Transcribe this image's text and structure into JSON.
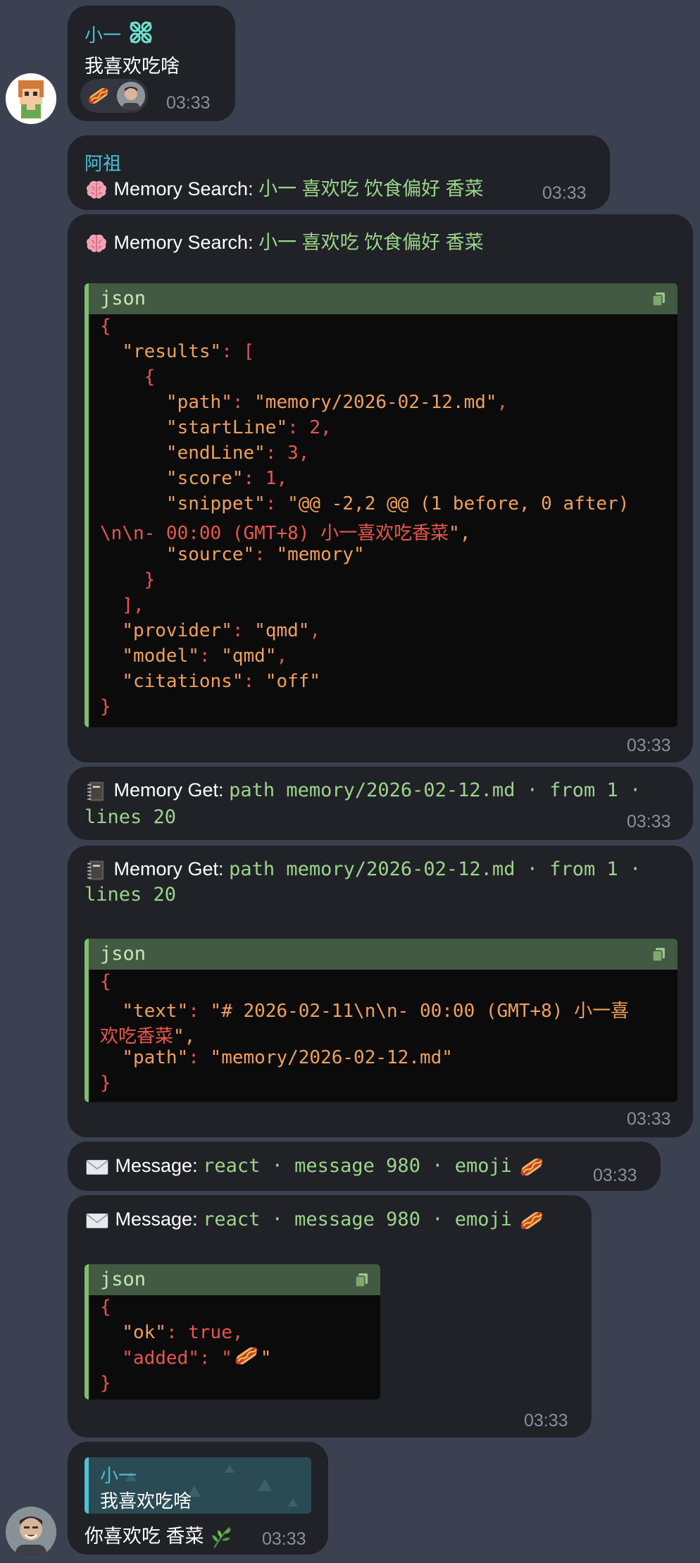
{
  "messages": {
    "m1": {
      "sender": "小一",
      "text": "我喜欢吃啥",
      "time": "03:33",
      "reactions": [
        "hotdog",
        "avatar"
      ]
    },
    "m2": {
      "sender": "阿祖",
      "tool_label": "Memory Search:",
      "tool_args": "小一 喜欢吃 饮食偏好 香菜",
      "time": "03:33"
    },
    "m3": {
      "tool_label": "Memory Search:",
      "tool_args": "小一 喜欢吃 饮食偏好 香菜",
      "code_lang": "json",
      "code_lines": [
        "{",
        "  \"results\": [",
        "    {",
        "      \"path\": \"memory/2026-02-12.md\",",
        "      \"startLine\": 2,",
        "      \"endLine\": 3,",
        "      \"score\": 1,",
        "      \"snippet\": \"@@ -2,2 @@ (1 before, 0 after)",
        "\\n\\n- 00:00 (GMT+8) 小一喜欢吃香菜\",",
        "      \"source\": \"memory\"",
        "    }",
        "  ],",
        "  \"provider\": \"qmd\",",
        "  \"model\": \"qmd\",",
        "  \"citations\": \"off\"",
        "}"
      ],
      "time": "03:33"
    },
    "m4": {
      "tool_label": "Memory Get:",
      "tool_args_line1": "path memory/2026-02-12.md · from 1 ·",
      "tool_args_line2": "lines 20",
      "time": "03:33"
    },
    "m5": {
      "tool_label": "Memory Get:",
      "tool_args_line1": "path memory/2026-02-12.md · from 1 ·",
      "tool_args_line2": "lines 20",
      "code_lang": "json",
      "code_lines": [
        "{",
        "  \"text\": \"# 2026-02-11\\n\\n- 00:00 (GMT+8) 小一喜",
        "欢吃香菜\",",
        "  \"path\": \"memory/2026-02-12.md\"",
        "}"
      ],
      "time": "03:33"
    },
    "m6": {
      "tool_label": "Message:",
      "tool_args": "react · message 980 · emoji",
      "time": "03:33"
    },
    "m7": {
      "tool_label": "Message:",
      "tool_args": "react · message 980 · emoji",
      "code_lang": "json",
      "code_lines": [
        "{",
        "  \"ok\": true,",
        "  \"added\": \"",
        "}"
      ],
      "time": "03:33"
    },
    "m8": {
      "quote_sender": "小一",
      "quote_text": "我喜欢吃啥",
      "text": "你喜欢吃 香菜",
      "time": "03:33"
    }
  },
  "colors": {
    "background": "#3b4150",
    "bubble": "#202228",
    "accent_cyan": "#4dc1d4",
    "code_green": "#7fc06a",
    "code_red": "#e8574d"
  },
  "icons": [
    "brain-icon",
    "notebook-icon",
    "envelope-icon",
    "hotdog-icon",
    "copy-icon",
    "herb-icon",
    "sender-logo-icon"
  ]
}
